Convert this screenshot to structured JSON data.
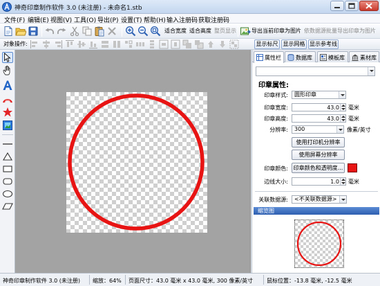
{
  "window": {
    "title": "神奇印章制作软件 3.0 (未注册) - 未命名1.stb"
  },
  "menu": [
    "文件(F)",
    "编辑(E)",
    "视图(V)",
    "工具(O)",
    "导出(P)",
    "设置(T)",
    "帮助(H)",
    "输入注册码",
    "获取注册码"
  ],
  "toolbar": {
    "fit_width": "适合宽度",
    "fit_height": "适合高度",
    "full_page": "整页显示",
    "export_current": "导出当前印章为图片",
    "export_batch": "依数据源批量导出印章为图片"
  },
  "object_bar": {
    "label": "对象操作:",
    "show_ruler": "显示标尺",
    "show_grid": "显示网格",
    "show_guides": "显示参考线"
  },
  "tabs": [
    "属性栏",
    "数据库",
    "模板库",
    "素材库"
  ],
  "props": {
    "heading": "印章属性:",
    "style": {
      "label": "印章样式:",
      "value": "圆形印章"
    },
    "width": {
      "label": "印章宽度:",
      "value": "43.0",
      "unit": "毫米"
    },
    "height": {
      "label": "印章高度:",
      "value": "43.0",
      "unit": "毫米"
    },
    "dpi": {
      "label": "分辨率:",
      "value": "300",
      "unit": "像素/英寸"
    },
    "use_printer_dpi": "使用打印机分辨率",
    "use_screen_dpi": "使用屏幕分辨率",
    "color": {
      "label": "印章颜色:",
      "button": "印章颜色和透明度..."
    },
    "border": {
      "label": "边线大小:",
      "value": "1.0",
      "unit": "毫米"
    },
    "datasource": {
      "label": "关联数据源:",
      "value": "<不关联数据源>"
    }
  },
  "thumbnail": {
    "title": "缩览图"
  },
  "status": {
    "app": "神奇印章制作软件 3.0 (未注册)",
    "zoom": "缩放：64%",
    "page_size": "页面尺寸：43.0 毫米 x 43.0 毫米, 300 像素/英寸",
    "mouse_pos": "鼠标位置：-13.8 毫米, -12.5 毫米"
  },
  "colors": {
    "stamp": "#e81414",
    "thumbnail_header": "#3a6cbf",
    "close_button": "#c9392c",
    "canvas_bg": "#a3a3a3"
  }
}
